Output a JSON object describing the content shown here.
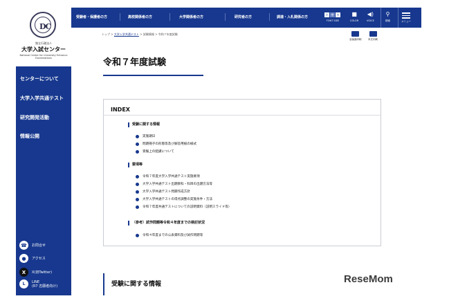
{
  "logo": {
    "org_small": "独立行政法人",
    "name": "大学入試センター",
    "name_en": "National Center for University Entrance Examinations"
  },
  "sidebar": {
    "items": [
      {
        "label": "センターについて"
      },
      {
        "label": "大学入学共通テスト"
      },
      {
        "label": "研究開発活動"
      },
      {
        "label": "情報公開"
      }
    ],
    "footer": [
      {
        "icon": "phone-icon",
        "label": "お問合せ"
      },
      {
        "icon": "map-pin-icon",
        "label": "アクセス"
      },
      {
        "icon": "x-icon",
        "label": "X(旧Twitter)"
      },
      {
        "icon": "line-icon",
        "label": "LINE",
        "sub": "(R7 志願者向け)"
      }
    ]
  },
  "topnav": {
    "items": [
      {
        "label": "受験者・保護者の方"
      },
      {
        "label": "高校関係者の方"
      },
      {
        "label": "大学関係者の方"
      },
      {
        "label": "研究者の方"
      },
      {
        "label": "調達・入札関係の方"
      }
    ],
    "tools": {
      "font_size_label": "FONT SIZE",
      "font_size_options": [
        "小",
        "中",
        "大"
      ],
      "color_label": "COLOR",
      "voice_label": "VOICE",
      "search_label": "検索",
      "menu_label": "メニュー"
    }
  },
  "breadcrumb": {
    "home": "トップ",
    "level1": "大学入学共通テスト",
    "level2": "試験情報",
    "current": "令和７年度試験",
    "sep": ">"
  },
  "print_tools": {
    "full_print": "全画面印刷",
    "body_print": "本文印刷"
  },
  "page": {
    "title": "令和７年度試験",
    "index_heading": "INDEX",
    "sections": [
      {
        "label": "受験に関する情報",
        "items": [
          "実施期日",
          "問題冊子の形態等及び解答用紙の様式",
          "受験上の配慮について"
        ]
      },
      {
        "label": "要項等",
        "items": [
          "令和７年度大学入学共通テスト実施要項",
          "大学入学共通テスト出題教科・科目の出題方法等",
          "大学入学共通テスト問題作成方針",
          "大学入学共通テストの得点調整の実施条件・方法",
          "令和７年度共通テストについての説明資料（説明スライド等）"
        ]
      },
      {
        "label": "（参考）試作問題等令和４年度までの検討状況",
        "items": [
          "令和４年度までの公表資料及び試作問題等"
        ]
      }
    ],
    "section2_title": "受験に関する情報"
  },
  "watermark": "ReseMom",
  "colors": {
    "brand": "#17388e"
  }
}
